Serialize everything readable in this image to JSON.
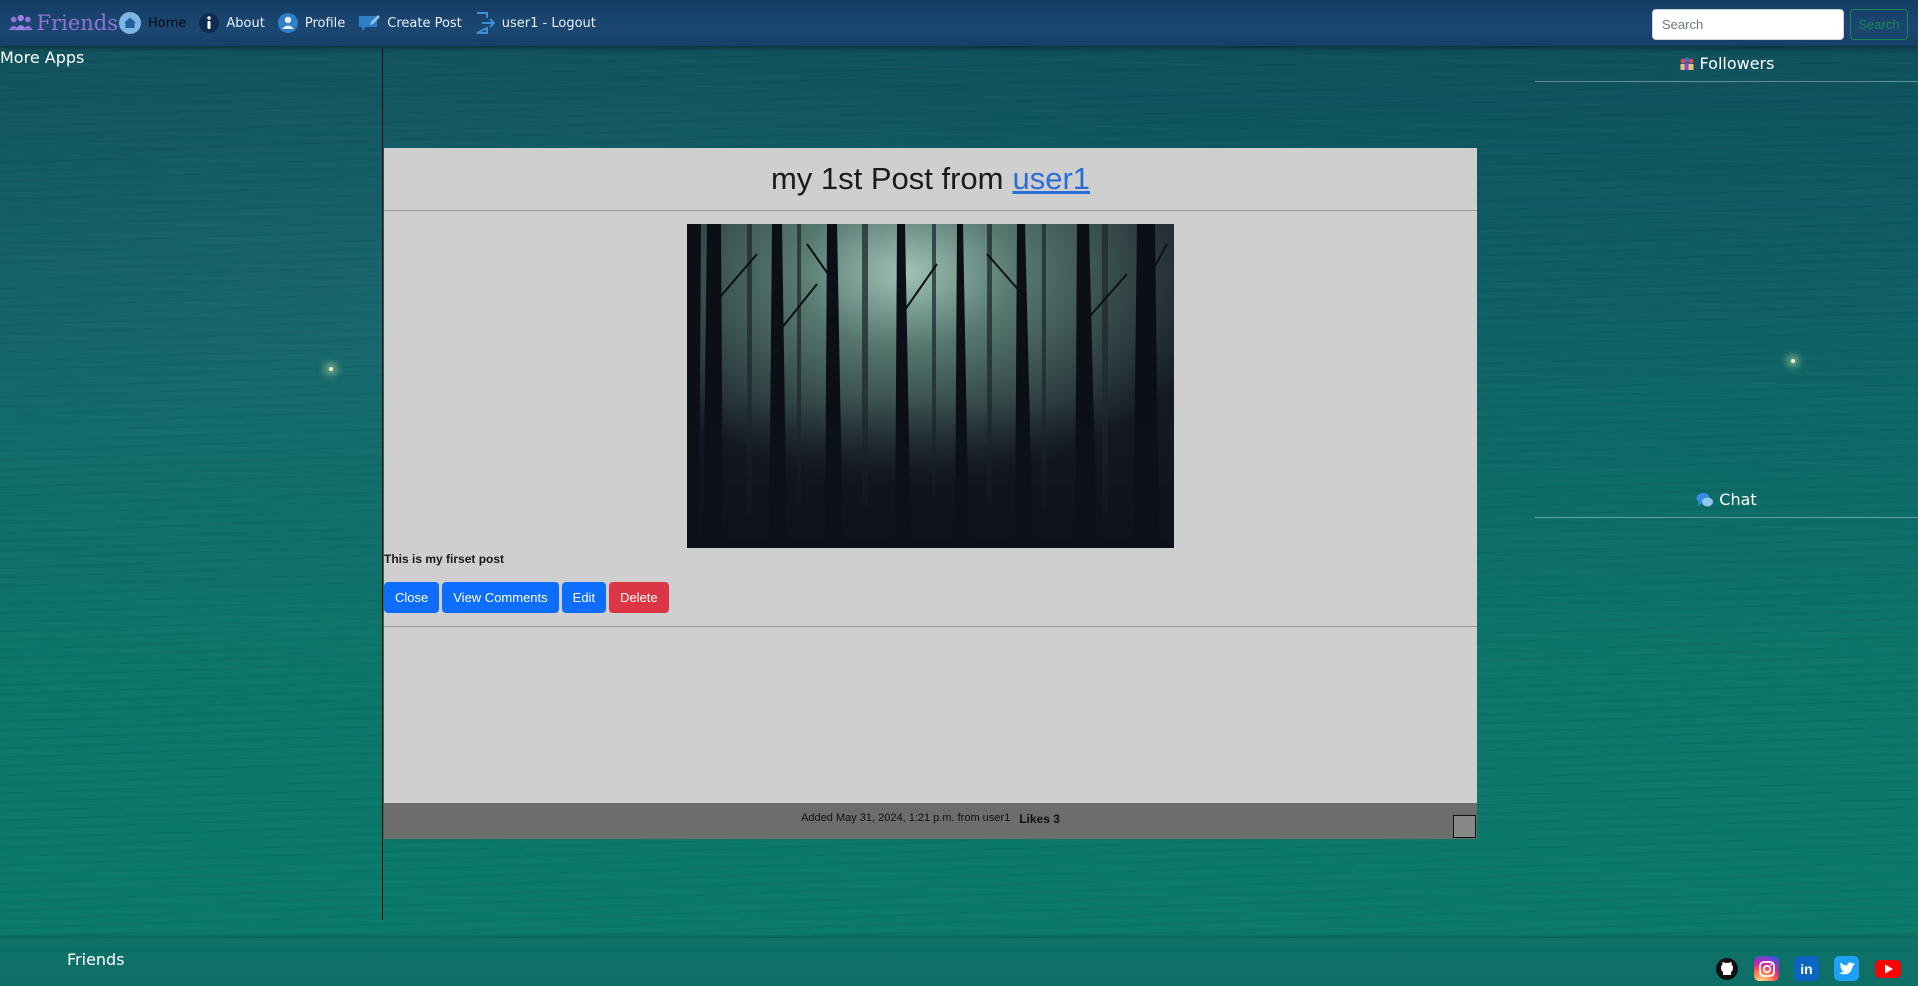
{
  "app": {
    "brand": "Friends"
  },
  "nav": {
    "items": [
      {
        "label": "Home",
        "icon": "home-icon",
        "active": true
      },
      {
        "label": "About",
        "icon": "info-icon"
      },
      {
        "label": "Profile",
        "icon": "user-icon"
      },
      {
        "label": "Create Post",
        "icon": "create-post-icon"
      },
      {
        "label": "user1 - Logout",
        "icon": "logout-icon"
      }
    ],
    "search": {
      "placeholder": "Search",
      "button_label": "Search"
    }
  },
  "left_sidebar": {
    "title": "More Apps"
  },
  "right_sidebar": {
    "followers_title": "Followers",
    "chat_title": "Chat"
  },
  "post": {
    "title_prefix": "my 1st Post from",
    "author": "user1",
    "text": "This is my firset post",
    "buttons": {
      "close": "Close",
      "view_comments": "View Comments",
      "edit": "Edit",
      "delete": "Delete"
    },
    "added": "Added May 31, 2024, 1:21 p.m. from user1",
    "likes": "Likes 3"
  },
  "footer": {
    "brand": "Friends",
    "socials": [
      "github-icon",
      "instagram-icon",
      "linkedin-icon",
      "twitter-icon",
      "youtube-icon"
    ]
  },
  "colors": {
    "navbar": "#173f68",
    "card": "#cfcfcf",
    "primary": "#0d6efd",
    "danger": "#dc3545",
    "success": "#198754"
  }
}
